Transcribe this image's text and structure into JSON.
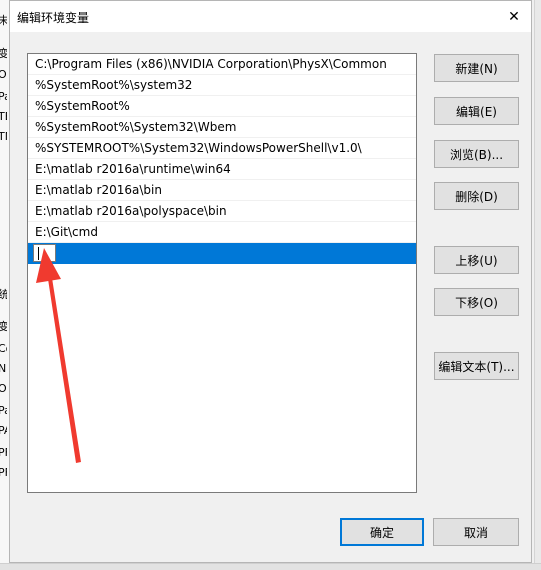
{
  "dialog": {
    "title": "编辑环境变量",
    "close_glyph": "✕"
  },
  "paths": [
    "C:\\Program Files (x86)\\NVIDIA Corporation\\PhysX\\Common",
    "%SystemRoot%\\system32",
    "%SystemRoot%",
    "%SystemRoot%\\System32\\Wbem",
    "%SYSTEMROOT%\\System32\\WindowsPowerShell\\v1.0\\",
    "E:\\matlab r2016a\\runtime\\win64",
    "E:\\matlab r2016a\\bin",
    "E:\\matlab r2016a\\polyspace\\bin",
    "E:\\Git\\cmd"
  ],
  "editing_row_value": "",
  "buttons": {
    "new": "新建(N)",
    "edit": "编辑(E)",
    "browse": "浏览(B)...",
    "delete": "删除(D)",
    "move_up": "上移(U)",
    "move_down": "下移(O)",
    "edit_text": "编辑文本(T)...",
    "ok": "确定",
    "cancel": "取消"
  },
  "background_fragments": [
    "末",
    "变",
    "O",
    "Pa",
    "TE",
    "TN",
    "统",
    "变",
    "Co",
    "N",
    "O",
    "Pa",
    "PA",
    "PF",
    "PF"
  ],
  "annotation": {
    "color": "#f03a2f"
  }
}
